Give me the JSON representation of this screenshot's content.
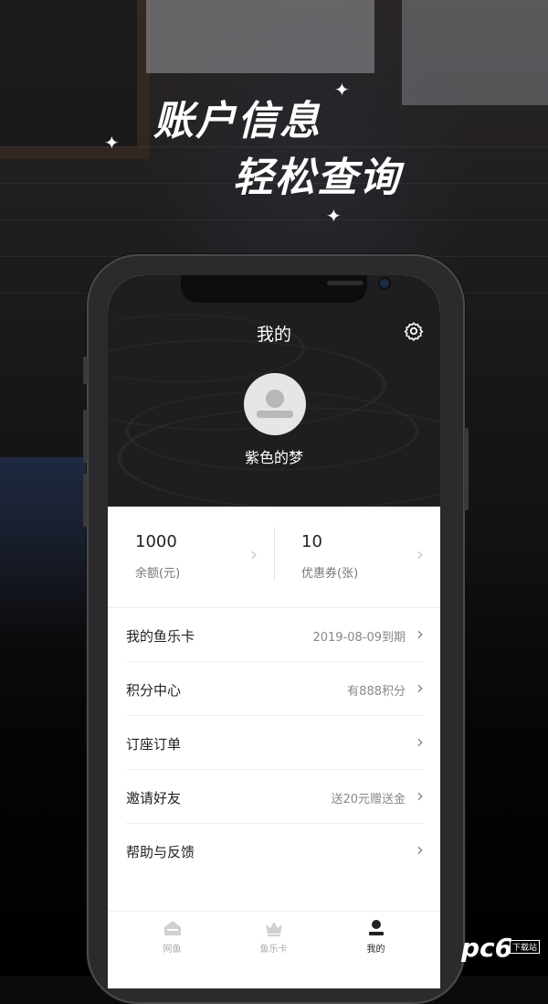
{
  "headline": {
    "line1": "账户信息",
    "line2": "轻松查询"
  },
  "header": {
    "title": "我的",
    "settings_icon": "gear-icon"
  },
  "profile": {
    "name": "紫色的梦",
    "avatar_icon": "user-avatar-icon"
  },
  "stats": [
    {
      "value": "1000",
      "label": "余额(元)"
    },
    {
      "value": "10",
      "label": "优惠券(张)"
    }
  ],
  "menu": [
    {
      "label": "我的鱼乐卡",
      "value": "2019-08-09到期"
    },
    {
      "label": "积分中心",
      "value": "有888积分"
    },
    {
      "label": "订座订单",
      "value": ""
    },
    {
      "label": "邀请好友",
      "value": "送20元赠送金"
    },
    {
      "label": "帮助与反馈",
      "value": ""
    }
  ],
  "tabs": [
    {
      "label": "网鱼",
      "icon": "home-icon",
      "active": false
    },
    {
      "label": "鱼乐卡",
      "icon": "crown-icon",
      "active": false
    },
    {
      "label": "我的",
      "icon": "user-icon",
      "active": true
    }
  ],
  "watermark": {
    "text": "pc6",
    "badge": "下载站"
  },
  "colors": {
    "dark_header": "#1e1e20",
    "accent_text": "#222222",
    "muted": "#888888"
  }
}
